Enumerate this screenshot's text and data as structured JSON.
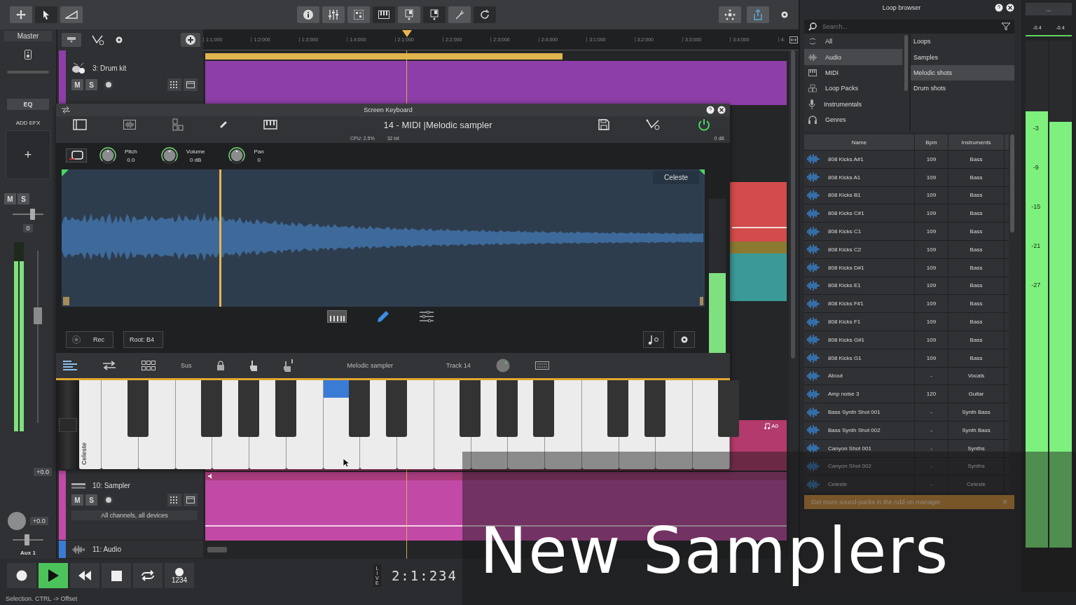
{
  "toolbar": {
    "left_tools": [
      {
        "kind": "move",
        "selected": false
      },
      {
        "kind": "pointer",
        "selected": true
      },
      {
        "kind": "ramp",
        "selected": false
      }
    ],
    "center_tools": [
      {
        "kind": "info",
        "selected": false
      },
      {
        "kind": "mixer",
        "selected": false
      },
      {
        "kind": "grid",
        "selected": false
      },
      {
        "kind": "piano",
        "selected": true
      },
      {
        "kind": "track",
        "selected": false
      },
      {
        "kind": "track",
        "selected": true
      },
      {
        "kind": "tuner",
        "selected": false
      },
      {
        "kind": "loop",
        "selected": true
      }
    ],
    "right_tools": [
      {
        "kind": "network",
        "selected": false
      },
      {
        "kind": "share",
        "selected": false
      }
    ]
  },
  "master": {
    "title": "Master",
    "eq": "EQ",
    "add_efx": "ADD EFX",
    "add_symbol": "+",
    "mute": "M",
    "solo": "S",
    "fader_value": "0",
    "fader": {
      "level": 0.62
    },
    "meter": {
      "level": 0.9
    },
    "gain": "+0.0",
    "aux_gain": "+0.0",
    "aux_label": "Aux 1",
    "aux_fader": {
      "level": 0.45
    }
  },
  "ruler": {
    "ticks": [
      "1:1:000",
      "1:2:000",
      "1:3:000",
      "1:4:000",
      "2:1:000",
      "2:2:000",
      "2:3:000",
      "2:4:000",
      "3:1:000",
      "3:2:000",
      "3:3:000",
      "3:4:000",
      "4:"
    ]
  },
  "drum_track": {
    "name": "3: Drum kit",
    "mute": "M",
    "solo": "S",
    "color": "#8e3ea8"
  },
  "sampler_track": {
    "name": "10: Sampler",
    "mute": "M",
    "solo": "S",
    "input": "All channels, all devices",
    "color": "#c04aa5"
  },
  "audio_track": {
    "name": "11: Audio",
    "color": "#3a7bd5"
  },
  "lane_label": "A0",
  "keyboard_window": {
    "title": "Screen Keyboard",
    "heading": "14 - MIDI |Melodic sampler",
    "cpu": "CPU: 2.5%",
    "bits": "32 bit",
    "gain": "0 dB",
    "powered": true,
    "knobs": [
      {
        "label": "Pitch",
        "value": "0.0"
      },
      {
        "label": "Volume",
        "value": "0 dB"
      },
      {
        "label": "Pan",
        "value": "0"
      }
    ],
    "sample_name": "Celeste",
    "rec": "Rec",
    "root": "Root: B4",
    "sus": "Sus",
    "instrument": "Melodic sampler",
    "track": "Track 14",
    "keyboard_label": "Celeste",
    "meter": {
      "level": 0.52
    },
    "white_keys": [
      {
        "pressed": false
      },
      {
        "pressed": false
      },
      {
        "pressed": false
      },
      {
        "pressed": false
      },
      {
        "pressed": false
      },
      {
        "pressed": false
      },
      {
        "pressed": false
      },
      {
        "pressed": true
      },
      {
        "pressed": false
      },
      {
        "pressed": false
      },
      {
        "pressed": false
      },
      {
        "pressed": false
      },
      {
        "pressed": false
      },
      {
        "pressed": false
      },
      {
        "pressed": false
      },
      {
        "pressed": false
      },
      {
        "pressed": false
      },
      {
        "pressed": false
      }
    ]
  },
  "loop_browser": {
    "title": "Loop browser",
    "search_placeholder": "Search...",
    "categories": [
      {
        "kind": "all",
        "label": "All",
        "selected": false
      },
      {
        "kind": "audio",
        "label": "Audio",
        "selected": true
      },
      {
        "kind": "midi",
        "label": "MIDI",
        "selected": false
      },
      {
        "kind": "packs",
        "label": "Loop Packs",
        "selected": false
      },
      {
        "kind": "mic",
        "label": "Instrumentals",
        "selected": false
      },
      {
        "kind": "headphones",
        "label": "Genres",
        "selected": false
      }
    ],
    "subcategories": [
      {
        "label": "Loops",
        "selected": false
      },
      {
        "label": "Samples",
        "selected": false
      },
      {
        "label": "Melodic shots",
        "selected": true
      },
      {
        "label": "Drum shots",
        "selected": false
      }
    ],
    "columns": [
      "Name",
      "Bpm",
      "Instruments"
    ],
    "rows": [
      {
        "name": "808 Kicks A#1",
        "bpm": "109",
        "instrument": "Bass"
      },
      {
        "name": "808 Kicks A1",
        "bpm": "109",
        "instrument": "Bass"
      },
      {
        "name": "808 Kicks B1",
        "bpm": "109",
        "instrument": "Bass"
      },
      {
        "name": "808 Kicks C#1",
        "bpm": "109",
        "instrument": "Bass"
      },
      {
        "name": "808 Kicks C1",
        "bpm": "109",
        "instrument": "Bass"
      },
      {
        "name": "808 Kicks C2",
        "bpm": "109",
        "instrument": "Bass"
      },
      {
        "name": "808 Kicks D#1",
        "bpm": "109",
        "instrument": "Bass"
      },
      {
        "name": "808 Kicks E1",
        "bpm": "109",
        "instrument": "Bass"
      },
      {
        "name": "808 Kicks F#1",
        "bpm": "109",
        "instrument": "Bass"
      },
      {
        "name": "808 Kicks F1",
        "bpm": "109",
        "instrument": "Bass"
      },
      {
        "name": "808 Kicks G#1",
        "bpm": "109",
        "instrument": "Bass"
      },
      {
        "name": "808 Kicks G1",
        "bpm": "109",
        "instrument": "Bass"
      },
      {
        "name": "About",
        "bpm": "-",
        "instrument": "Vocals"
      },
      {
        "name": "Amp noise 3",
        "bpm": "120",
        "instrument": "Guitar"
      },
      {
        "name": "Bass Synth Shot 001",
        "bpm": "-",
        "instrument": "Synth Bass"
      },
      {
        "name": "Bass Synth Shot 002",
        "bpm": "-",
        "instrument": "Synth Bass"
      },
      {
        "name": "Canyon Shot 001",
        "bpm": "-",
        "instrument": "Synths"
      },
      {
        "name": "Canyon Shot 002",
        "bpm": "-",
        "instrument": "Synths"
      },
      {
        "name": "Celeste",
        "bpm": "-",
        "instrument": "Celeste"
      }
    ],
    "banner": "Get more sound-packs in the Add-on manager",
    "banner_close": "×"
  },
  "output_meter": {
    "menu": "...",
    "peaks": [
      "-0.4",
      "-0.4"
    ],
    "scale": [
      "-3",
      "-9",
      "-15",
      "-21",
      "-27"
    ],
    "channels": [
      {
        "level": 0.86
      },
      {
        "level": 0.84
      }
    ]
  },
  "transport": {
    "buttons": [
      {
        "kind": "record",
        "selected": false
      },
      {
        "kind": "play",
        "selected": true
      },
      {
        "kind": "rewind",
        "selected": false
      },
      {
        "kind": "stop",
        "selected": false
      },
      {
        "kind": "loop",
        "selected": false
      },
      {
        "kind": "metronome",
        "selected": false,
        "label": "1234"
      }
    ],
    "live": "LIVE",
    "time": "2:1:234"
  },
  "caption": "New Samplers",
  "status_bar": "Selection. CTRL -> Offset"
}
